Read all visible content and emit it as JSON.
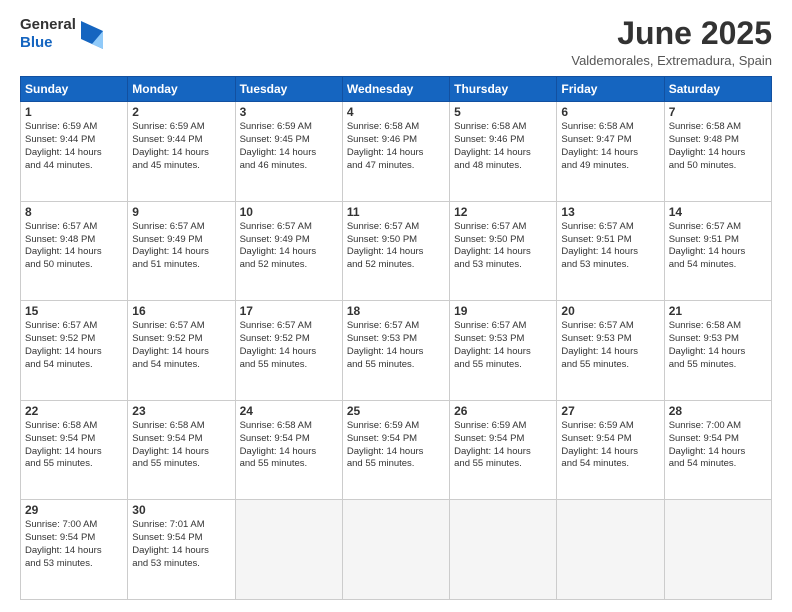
{
  "logo": {
    "general": "General",
    "blue": "Blue"
  },
  "header": {
    "month": "June 2025",
    "location": "Valdemorales, Extremadura, Spain"
  },
  "weekdays": [
    "Sunday",
    "Monday",
    "Tuesday",
    "Wednesday",
    "Thursday",
    "Friday",
    "Saturday"
  ],
  "weeks": [
    [
      {
        "day": 1,
        "info": "Sunrise: 6:59 AM\nSunset: 9:44 PM\nDaylight: 14 hours\nand 44 minutes."
      },
      {
        "day": 2,
        "info": "Sunrise: 6:59 AM\nSunset: 9:44 PM\nDaylight: 14 hours\nand 45 minutes."
      },
      {
        "day": 3,
        "info": "Sunrise: 6:59 AM\nSunset: 9:45 PM\nDaylight: 14 hours\nand 46 minutes."
      },
      {
        "day": 4,
        "info": "Sunrise: 6:58 AM\nSunset: 9:46 PM\nDaylight: 14 hours\nand 47 minutes."
      },
      {
        "day": 5,
        "info": "Sunrise: 6:58 AM\nSunset: 9:46 PM\nDaylight: 14 hours\nand 48 minutes."
      },
      {
        "day": 6,
        "info": "Sunrise: 6:58 AM\nSunset: 9:47 PM\nDaylight: 14 hours\nand 49 minutes."
      },
      {
        "day": 7,
        "info": "Sunrise: 6:58 AM\nSunset: 9:48 PM\nDaylight: 14 hours\nand 50 minutes."
      }
    ],
    [
      {
        "day": 8,
        "info": "Sunrise: 6:57 AM\nSunset: 9:48 PM\nDaylight: 14 hours\nand 50 minutes."
      },
      {
        "day": 9,
        "info": "Sunrise: 6:57 AM\nSunset: 9:49 PM\nDaylight: 14 hours\nand 51 minutes."
      },
      {
        "day": 10,
        "info": "Sunrise: 6:57 AM\nSunset: 9:49 PM\nDaylight: 14 hours\nand 52 minutes."
      },
      {
        "day": 11,
        "info": "Sunrise: 6:57 AM\nSunset: 9:50 PM\nDaylight: 14 hours\nand 52 minutes."
      },
      {
        "day": 12,
        "info": "Sunrise: 6:57 AM\nSunset: 9:50 PM\nDaylight: 14 hours\nand 53 minutes."
      },
      {
        "day": 13,
        "info": "Sunrise: 6:57 AM\nSunset: 9:51 PM\nDaylight: 14 hours\nand 53 minutes."
      },
      {
        "day": 14,
        "info": "Sunrise: 6:57 AM\nSunset: 9:51 PM\nDaylight: 14 hours\nand 54 minutes."
      }
    ],
    [
      {
        "day": 15,
        "info": "Sunrise: 6:57 AM\nSunset: 9:52 PM\nDaylight: 14 hours\nand 54 minutes."
      },
      {
        "day": 16,
        "info": "Sunrise: 6:57 AM\nSunset: 9:52 PM\nDaylight: 14 hours\nand 54 minutes."
      },
      {
        "day": 17,
        "info": "Sunrise: 6:57 AM\nSunset: 9:52 PM\nDaylight: 14 hours\nand 55 minutes."
      },
      {
        "day": 18,
        "info": "Sunrise: 6:57 AM\nSunset: 9:53 PM\nDaylight: 14 hours\nand 55 minutes."
      },
      {
        "day": 19,
        "info": "Sunrise: 6:57 AM\nSunset: 9:53 PM\nDaylight: 14 hours\nand 55 minutes."
      },
      {
        "day": 20,
        "info": "Sunrise: 6:57 AM\nSunset: 9:53 PM\nDaylight: 14 hours\nand 55 minutes."
      },
      {
        "day": 21,
        "info": "Sunrise: 6:58 AM\nSunset: 9:53 PM\nDaylight: 14 hours\nand 55 minutes."
      }
    ],
    [
      {
        "day": 22,
        "info": "Sunrise: 6:58 AM\nSunset: 9:54 PM\nDaylight: 14 hours\nand 55 minutes."
      },
      {
        "day": 23,
        "info": "Sunrise: 6:58 AM\nSunset: 9:54 PM\nDaylight: 14 hours\nand 55 minutes."
      },
      {
        "day": 24,
        "info": "Sunrise: 6:58 AM\nSunset: 9:54 PM\nDaylight: 14 hours\nand 55 minutes."
      },
      {
        "day": 25,
        "info": "Sunrise: 6:59 AM\nSunset: 9:54 PM\nDaylight: 14 hours\nand 55 minutes."
      },
      {
        "day": 26,
        "info": "Sunrise: 6:59 AM\nSunset: 9:54 PM\nDaylight: 14 hours\nand 55 minutes."
      },
      {
        "day": 27,
        "info": "Sunrise: 6:59 AM\nSunset: 9:54 PM\nDaylight: 14 hours\nand 54 minutes."
      },
      {
        "day": 28,
        "info": "Sunrise: 7:00 AM\nSunset: 9:54 PM\nDaylight: 14 hours\nand 54 minutes."
      }
    ],
    [
      {
        "day": 29,
        "info": "Sunrise: 7:00 AM\nSunset: 9:54 PM\nDaylight: 14 hours\nand 53 minutes."
      },
      {
        "day": 30,
        "info": "Sunrise: 7:01 AM\nSunset: 9:54 PM\nDaylight: 14 hours\nand 53 minutes."
      },
      null,
      null,
      null,
      null,
      null
    ]
  ]
}
